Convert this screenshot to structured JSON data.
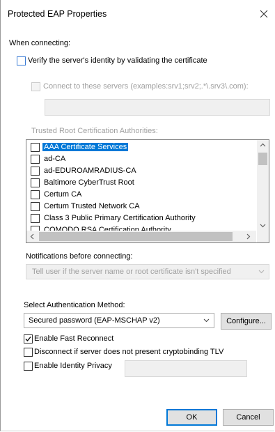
{
  "window": {
    "title": "Protected EAP Properties",
    "close_glyph": "✕"
  },
  "when_connecting": {
    "label": "When connecting:",
    "verify_cert": {
      "label": "Verify the server's identity by validating the certificate",
      "checked": false
    },
    "connect_servers": {
      "label": "Connect to these servers (examples:srv1;srv2;.*\\.srv3\\.com):",
      "checked": false,
      "enabled": false,
      "value": ""
    },
    "trusted_roots_label": "Trusted Root Certification Authorities:",
    "trusted_roots": [
      {
        "label": "AAA Certificate Services",
        "checked": false,
        "selected": true
      },
      {
        "label": "ad-CA",
        "checked": false,
        "selected": false
      },
      {
        "label": "ad-EDUROAMRADIUS-CA",
        "checked": false,
        "selected": false
      },
      {
        "label": "Baltimore CyberTrust Root",
        "checked": false,
        "selected": false
      },
      {
        "label": "Certum CA",
        "checked": false,
        "selected": false
      },
      {
        "label": "Certum Trusted Network CA",
        "checked": false,
        "selected": false
      },
      {
        "label": "Class 3 Public Primary Certification Authority",
        "checked": false,
        "selected": false
      },
      {
        "label": "COMODO RSA Certification Authority",
        "checked": false,
        "selected": false
      }
    ],
    "notifications_label": "Notifications before connecting:",
    "notifications_value": "Tell user if the server name or root certificate isn't specified"
  },
  "auth_method": {
    "label": "Select Authentication Method:",
    "value": "Secured password (EAP-MSCHAP v2)",
    "configure_label": "Configure..."
  },
  "options": {
    "fast_reconnect": {
      "label": "Enable Fast Reconnect",
      "checked": true
    },
    "disconnect_tlv": {
      "label": "Disconnect if server does not present cryptobinding TLV",
      "checked": false
    },
    "identity_privacy": {
      "label": "Enable Identity Privacy",
      "checked": false,
      "value": ""
    }
  },
  "footer": {
    "ok_label": "OK",
    "cancel_label": "Cancel"
  }
}
